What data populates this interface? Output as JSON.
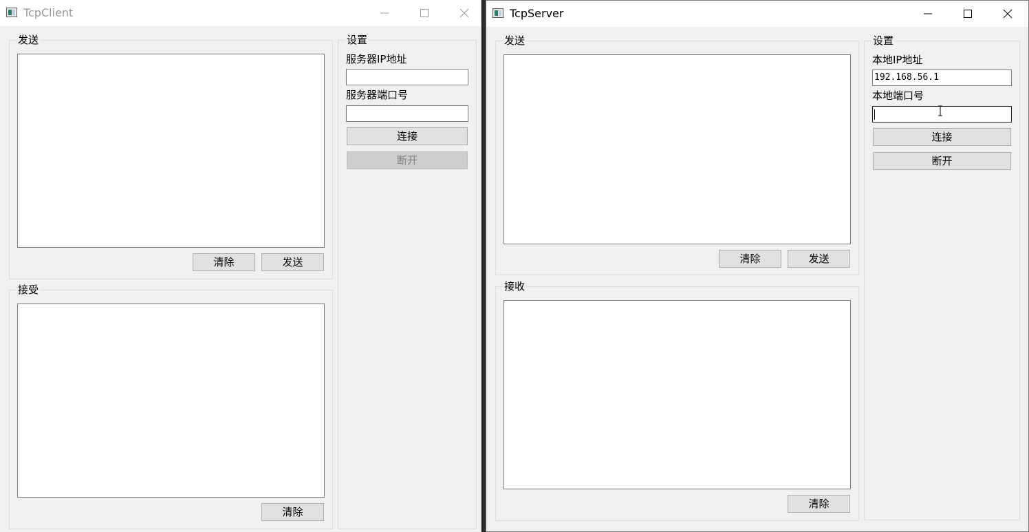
{
  "client": {
    "title": "TcpClient",
    "send_group": {
      "label": "发送",
      "clear_label": "清除",
      "send_label": "发送"
    },
    "recv_group": {
      "label": "接受",
      "clear_label": "清除"
    },
    "settings": {
      "label": "设置",
      "ip_label": "服务器IP地址",
      "ip_value": "",
      "port_label": "服务器端口号",
      "port_value": "",
      "connect_label": "连接",
      "disconnect_label": "断开"
    }
  },
  "server": {
    "title": "TcpServer",
    "send_group": {
      "label": "发送",
      "clear_label": "清除",
      "send_label": "发送"
    },
    "recv_group": {
      "label": "接收",
      "clear_label": "清除"
    },
    "settings": {
      "label": "设置",
      "ip_label": "本地IP地址",
      "ip_value": "192.168.56.1",
      "port_label": "本地端口号",
      "port_value": "",
      "connect_label": "连接",
      "disconnect_label": "断开"
    }
  }
}
